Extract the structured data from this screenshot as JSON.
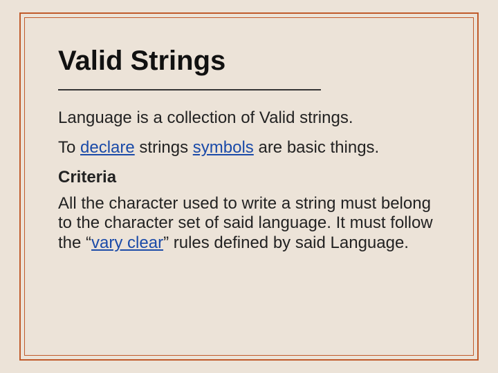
{
  "slide": {
    "title": "Valid Strings",
    "para1": "Language is a collection of Valid strings.",
    "para2_pre": "To ",
    "para2_link1": "declare",
    "para2_mid": " strings ",
    "para2_link2": "symbols",
    "para2_post": " are basic things.",
    "subhead": "Criteria",
    "para3_pre": "All the character used to write a string must belong to the character set of said language. It must follow the “",
    "para3_link": "vary clear",
    "para3_post": "” rules defined by said Language."
  }
}
